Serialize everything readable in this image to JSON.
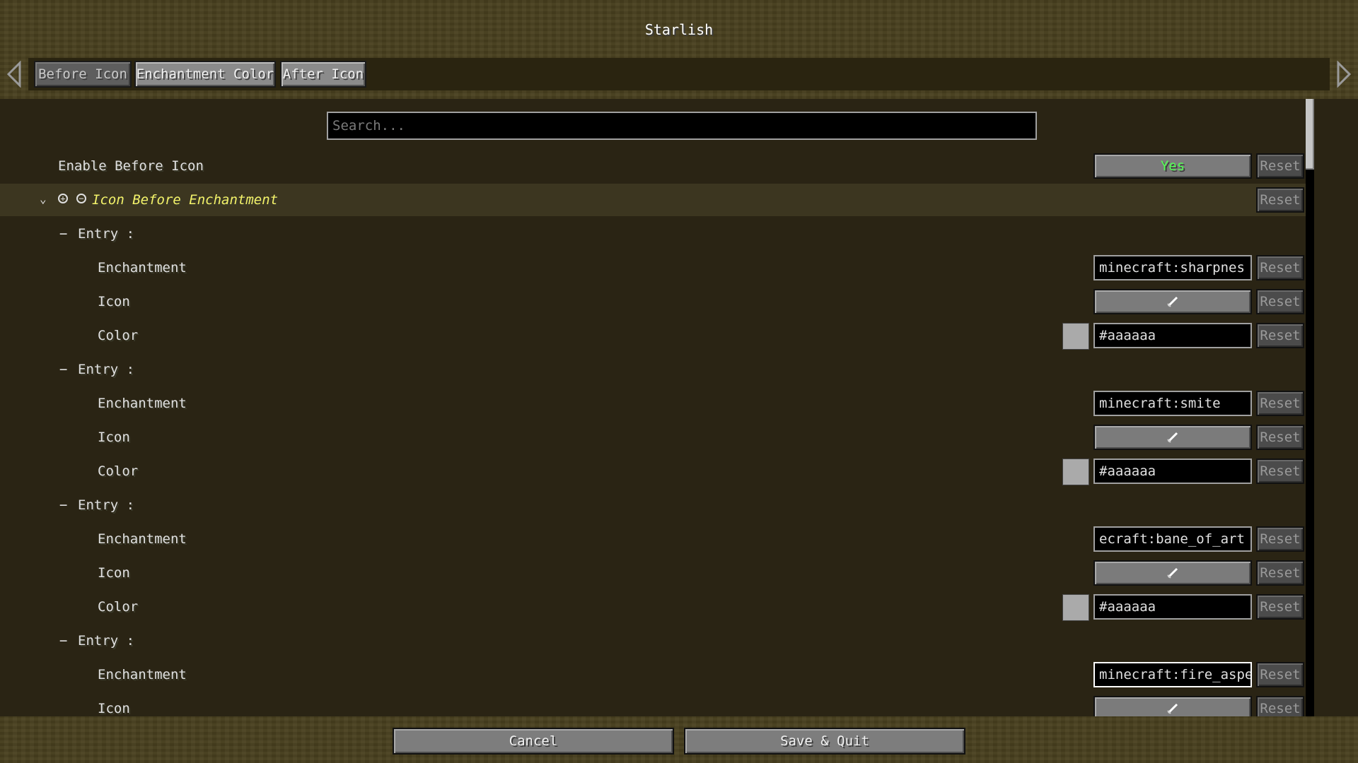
{
  "window": {
    "title": "Starlish"
  },
  "tabs": [
    {
      "label": "Before Icon",
      "active": false
    },
    {
      "label": "Enchantment Color",
      "active": true
    },
    {
      "label": "After Icon",
      "active": true
    }
  ],
  "search": {
    "placeholder": "Search..."
  },
  "enable_before_icon": {
    "label": "Enable Before Icon",
    "value": "Yes",
    "reset_label": "Reset"
  },
  "category": {
    "label": "Icon Before Enchantment",
    "reset_label": "Reset"
  },
  "entry_label": "Entry :",
  "field_labels": {
    "enchantment": "Enchantment",
    "icon": "Icon",
    "color": "Color"
  },
  "reset_label": "Reset",
  "entries": [
    {
      "enchantment": "minecraft:sharpnes",
      "color": "#aaaaaa"
    },
    {
      "enchantment": "minecraft:smite",
      "color": "#aaaaaa"
    },
    {
      "enchantment": "ecraft:bane_of_art",
      "color": "#aaaaaa"
    },
    {
      "enchantment": "minecraft:fire_aspe"
    }
  ],
  "footer": {
    "cancel_label": "Cancel",
    "save_label": "Save & Quit"
  },
  "colors": {
    "swatch": "#aaaaaa",
    "yes_text": "#55ff55",
    "category_text": "#f4f36a"
  }
}
